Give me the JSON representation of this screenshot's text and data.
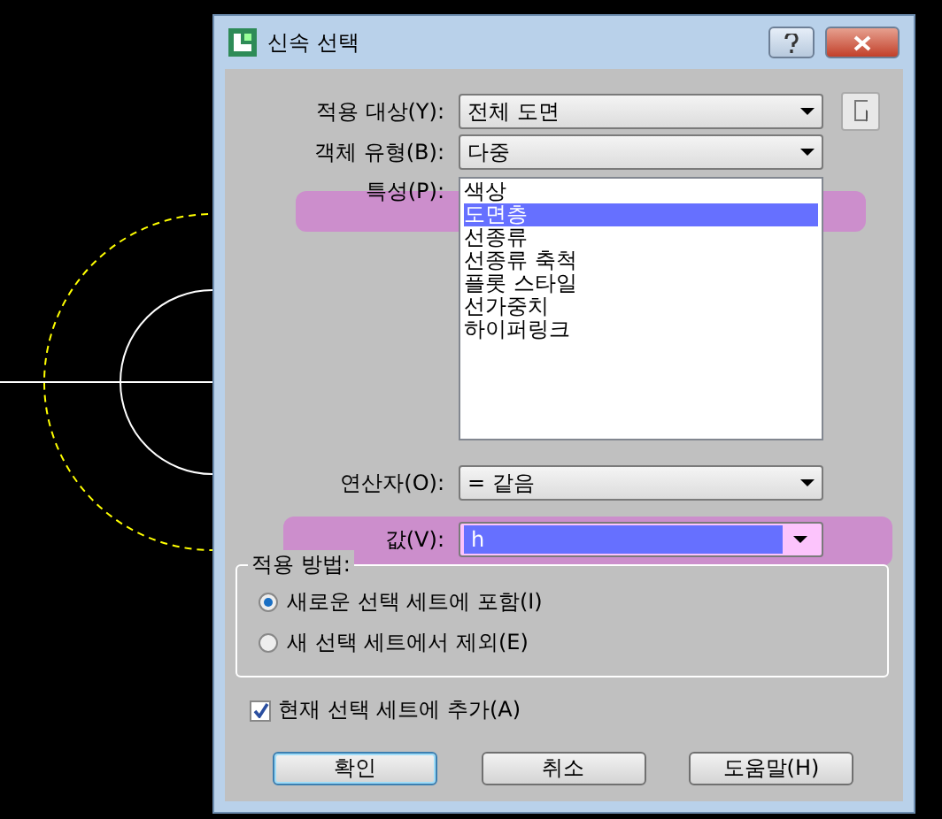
{
  "window": {
    "title": "신속 선택"
  },
  "apply_to": {
    "label": "적용 대상(Y):",
    "value": "전체 도면"
  },
  "object_type": {
    "label": "객체 유형(B):",
    "value": "다중"
  },
  "properties": {
    "label": "특성(P):",
    "items": [
      {
        "label": "색상",
        "selected": false
      },
      {
        "label": "도면층",
        "selected": true
      },
      {
        "label": "선종류",
        "selected": false
      },
      {
        "label": "선종류 축척",
        "selected": false
      },
      {
        "label": "플롯 스타일",
        "selected": false
      },
      {
        "label": "선가중치",
        "selected": false
      },
      {
        "label": "하이퍼링크",
        "selected": false
      }
    ]
  },
  "operator": {
    "label": "연산자(O):",
    "value": "= 같음"
  },
  "value": {
    "label": "값(V):",
    "value": "h"
  },
  "how_to_apply": {
    "title": "적용 방법:",
    "options": [
      {
        "label": "새로운 선택 세트에 포함(I)",
        "selected": true
      },
      {
        "label": "새 선택 세트에서 제외(E)",
        "selected": false
      }
    ]
  },
  "append": {
    "label": "현재 선택 세트에 추가(A)",
    "checked": true
  },
  "buttons": [
    "확인",
    "취소",
    "도움말(H)"
  ]
}
